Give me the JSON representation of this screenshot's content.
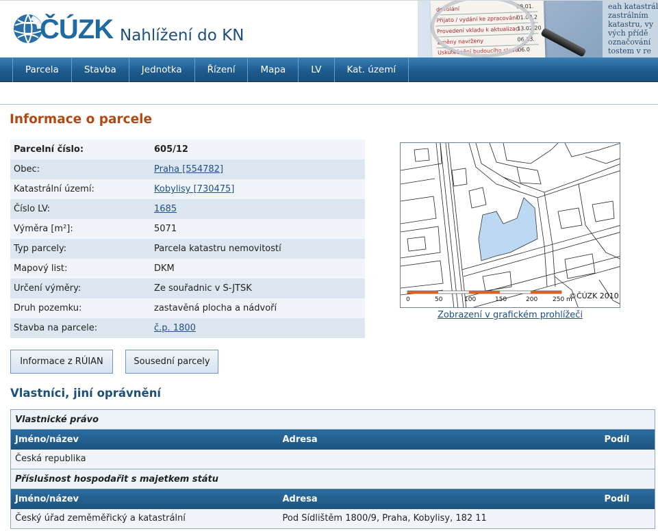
{
  "header": {
    "logo_text": "ČÚZK",
    "app_title": "Nahlížení do KN",
    "banner_doc_lines": [
      {
        "text": "dovolání",
        "date": "08.01."
      },
      {
        "text": "Přijato / vydání ke zpracování",
        "date": "01.02.2"
      },
      {
        "text": "Provedení vkladu k aktualizaci",
        "date": "13.02.20"
      },
      {
        "text": "Změny navrženy",
        "date": "06.03."
      },
      {
        "text": "Uskutečnění budoucího stavu",
        "date": "06.0"
      }
    ],
    "banner_map_words": [
      "eah katastrál",
      "zastrálním",
      "katastru, vy",
      "vých přídě",
      "označování",
      "tostem v re"
    ]
  },
  "nav": {
    "items": [
      "Parcela",
      "Stavba",
      "Jednotka",
      "Řízení",
      "Mapa",
      "LV",
      "Kat. území"
    ]
  },
  "page": {
    "title": "Informace o parcele"
  },
  "parcel": {
    "rows": [
      {
        "label": "Parcelní číslo:",
        "value": "605/12",
        "link": false
      },
      {
        "label": "Obec:",
        "value": "Praha [554782]",
        "link": true
      },
      {
        "label": "Katastrální území:",
        "value": "Kobylisy [730475]",
        "link": true
      },
      {
        "label": "Číslo LV:",
        "value": "1685",
        "link": true
      },
      {
        "label": "Výměra [m²]:",
        "value": "5071",
        "link": false
      },
      {
        "label": "Typ parcely:",
        "value": "Parcela katastru nemovitostí",
        "link": false
      },
      {
        "label": "Mapový list:",
        "value": "DKM",
        "link": false
      },
      {
        "label": "Určení výměry:",
        "value": "Ze souřadnic v S-JTSK",
        "link": false
      },
      {
        "label": "Druh pozemku:",
        "value": "zastavěná plocha a nádvoří",
        "link": false
      },
      {
        "label": "Stavba na parcele:",
        "value": "č.p. 1800",
        "link": true
      }
    ]
  },
  "map": {
    "scale_labels": [
      "0",
      "50",
      "100",
      "150",
      "200",
      "250 m"
    ],
    "copyright": "©ČÚZK 2010",
    "link_text": "Zobrazení v grafickém prohlížeči",
    "parcel_fill": "#bcd8f2"
  },
  "buttons": {
    "ruian": "Informace z RÚIAN",
    "neighbors": "Sousední parcely"
  },
  "owners": {
    "title": "Vlastníci, jiní oprávnění",
    "groups": [
      {
        "name": "Vlastnické právo",
        "headers": [
          "Jméno/název",
          "Adresa",
          "Podíl"
        ],
        "rows": [
          {
            "name": "Česká republika",
            "address": "",
            "share": ""
          }
        ]
      },
      {
        "name": "Příslušnost hospodařit s majetkem státu",
        "headers": [
          "Jméno/název",
          "Adresa",
          "Podíl"
        ],
        "rows": [
          {
            "name": "Český úřad zeměměřický a katastrální",
            "address": "Pod Sídlištěm 1800/9, Praha, Kobylisy, 182 11",
            "share": ""
          }
        ]
      }
    ]
  },
  "colors": {
    "accent_title": "#b4480e",
    "brand_blue": "#1f6aa1",
    "nav_blue": "#1e5c8f",
    "link_blue": "#1f4f85"
  }
}
